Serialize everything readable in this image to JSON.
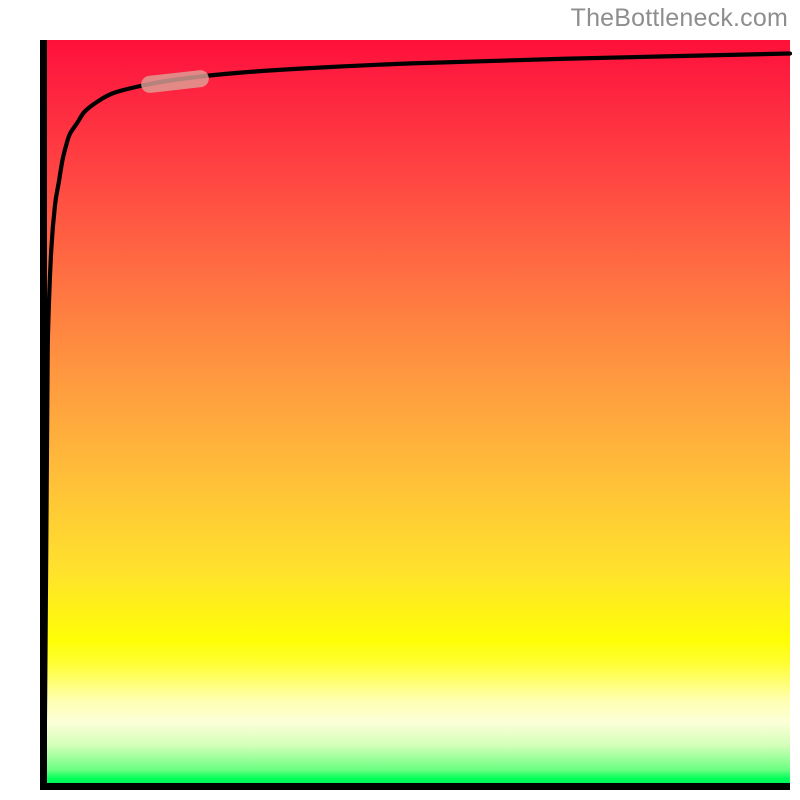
{
  "watermark": "TheBottleneck.com",
  "colors": {
    "curve": "#000000",
    "axis": "#000000",
    "highlight": "rgba(221,160,150,0.82)",
    "gradient_top": "#fe1038",
    "gradient_mid1": "#ff9640",
    "gradient_mid2": "#fffe06",
    "gradient_bottom": "#00e961",
    "watermark_text": "#8e8e8e"
  },
  "chart_data": {
    "type": "line",
    "title": "",
    "xlabel": "",
    "ylabel": "",
    "xlim": [
      0,
      100
    ],
    "ylim": [
      0,
      100
    ],
    "grid": false,
    "series": [
      {
        "name": "curve",
        "x": [
          0.6,
          0.8,
          1.0,
          1.1,
          1.5,
          2.0,
          2.5,
          3.0,
          3.5,
          4.0,
          5.0,
          6.0,
          8.0,
          10,
          14,
          18,
          25,
          35,
          50,
          70,
          100
        ],
        "y": [
          2.0,
          28,
          55,
          62,
          72,
          78,
          81,
          84,
          86,
          87.5,
          89,
          90.5,
          92,
          93,
          94,
          94.7,
          95.5,
          96.2,
          96.9,
          97.5,
          98.2
        ]
      }
    ],
    "highlight_segment": {
      "x_start": 14,
      "x_end": 22,
      "y_start": 94,
      "y_end": 94.9
    },
    "background_gradient_direction": "vertical",
    "legend": false
  }
}
